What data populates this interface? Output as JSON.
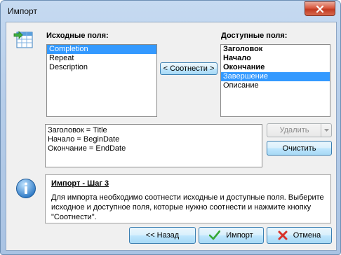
{
  "window": {
    "title": "Импорт"
  },
  "source_fields": {
    "label": "Исходные поля:",
    "items": [
      "Completion",
      "Repeat",
      "Description"
    ]
  },
  "available_fields": {
    "label": "Доступные поля:",
    "items": [
      "Заголовок",
      "Начало",
      "Окончание",
      "Завершение",
      "Описание"
    ]
  },
  "map_button": "< Соотнести >",
  "mappings": [
    "Заголовок = Title",
    "Начало = BeginDate",
    "Окончание = EndDate"
  ],
  "delete_button": "Удалить",
  "clear_button": "Очистить",
  "info": {
    "title": "Импорт - Шаг 3",
    "text": "Для импорта необходимо соотнести исходные и доступные поля. Выберите исходное и доступное поля, которые нужно соотнести и нажмите кнопку \"Соотнести\"."
  },
  "footer": {
    "back_button": "<< Назад",
    "import_button": "Импорт",
    "cancel_button": "Отмена"
  }
}
